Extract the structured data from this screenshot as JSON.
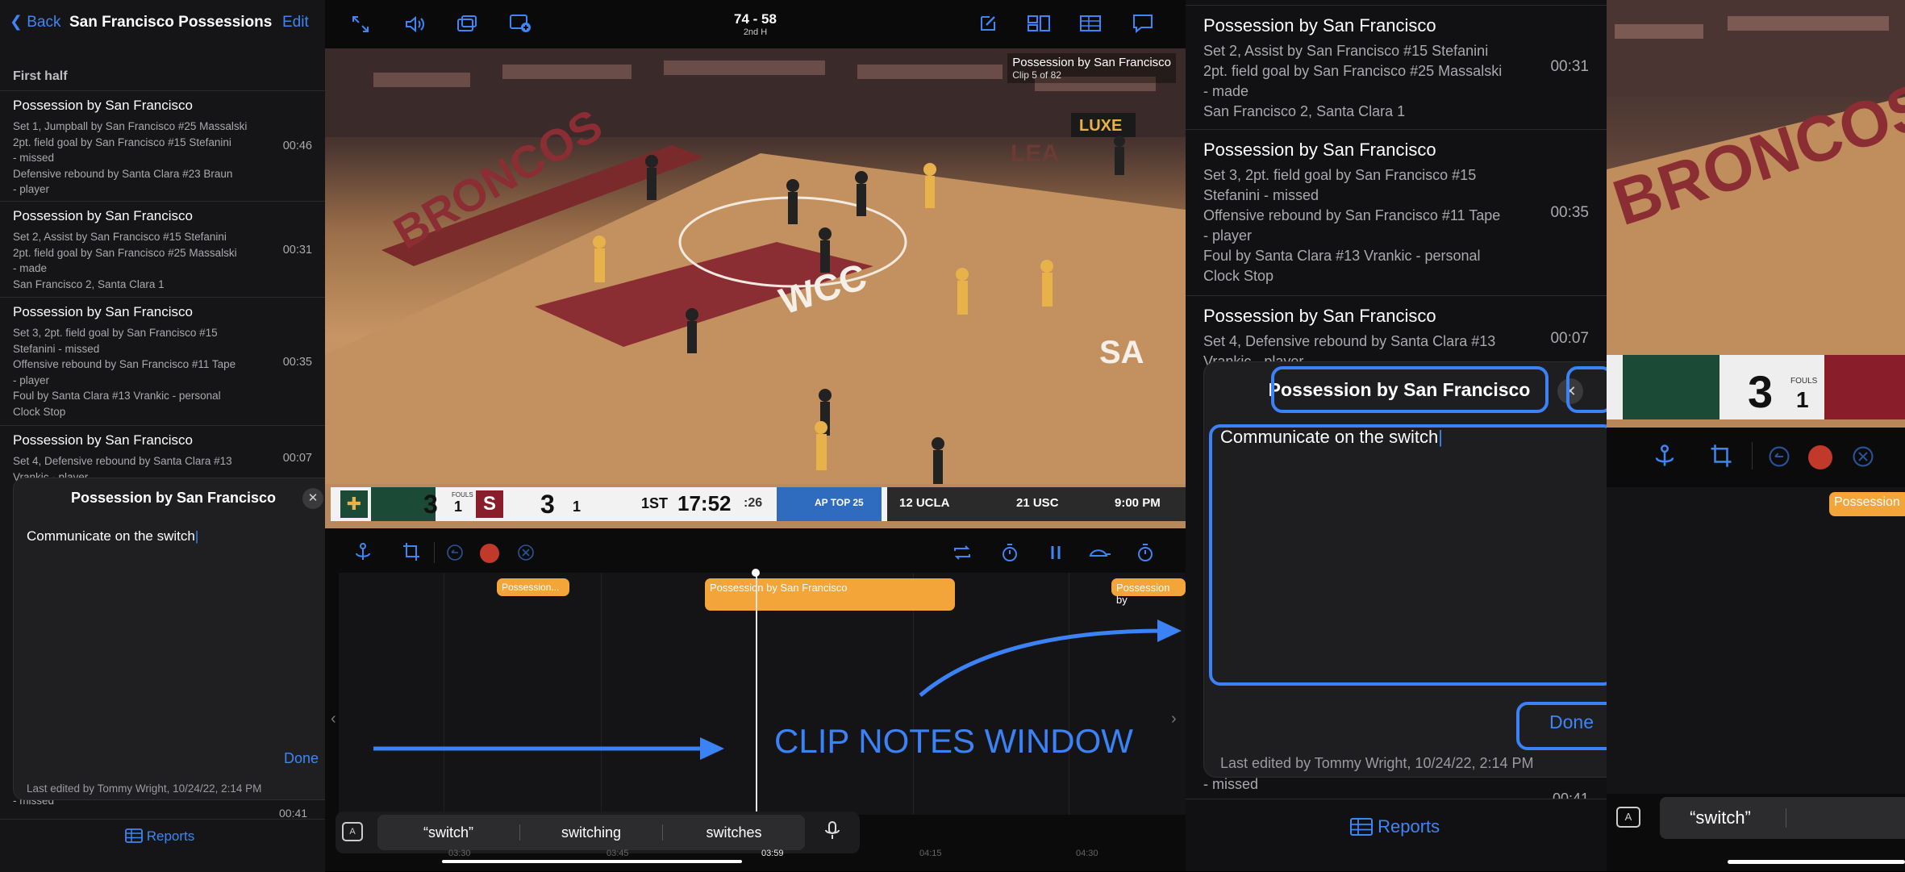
{
  "left_panel": {
    "back_label": "Back",
    "title": "San Francisco Possessions",
    "edit_label": "Edit",
    "section": "First half",
    "rows": [
      {
        "title": "Possession by San Francisco",
        "lines": [
          "Set 1, Jumpball by San Francisco #25 Massalski",
          "2pt. field goal by San Francisco #15 Stefanini",
          "- missed",
          "Defensive rebound by Santa Clara #23 Braun",
          "- player"
        ],
        "time": "00:46"
      },
      {
        "title": "Possession by San Francisco",
        "lines": [
          "Set 2, Assist by San Francisco #15 Stefanini",
          "2pt. field goal by San Francisco #25 Massalski",
          "- made",
          "San Francisco 2, Santa Clara 1"
        ],
        "time": "00:31"
      },
      {
        "title": "Possession by San Francisco",
        "lines": [
          "Set 3, 2pt. field goal by San Francisco #15",
          "Stefanini - missed",
          "Offensive rebound by San Francisco #11 Tape",
          "- player",
          "Foul by Santa Clara #13 Vrankic - personal",
          "Clock Stop"
        ],
        "time": "00:35"
      },
      {
        "title": "Possession by San Francisco",
        "lines": [
          "Set 4, Defensive rebound by Santa Clara #13",
          "Vrankic - player"
        ],
        "time": "00:07"
      }
    ],
    "below_note_lines": [
      "- missed"
    ],
    "below_note_time": "00:41",
    "reports_label": "Reports"
  },
  "note": {
    "title": "Possession by San Francisco",
    "close_symbol": "✕",
    "body": "Communicate on the switch",
    "done_label": "Done",
    "edited": "Last edited by Tommy Wright, 10/24/22, 2:14 PM"
  },
  "video": {
    "score_header": "74 - 58",
    "period": "2nd H",
    "overlay_title": "Possession by San Francisco",
    "overlay_sub": "Clip 5 of 82",
    "scorebug": {
      "home_score": "3",
      "away_score": "3",
      "half": "1ST",
      "clock": "17:52",
      "shot_clock": ":26",
      "ticker_brand": "AP TOP 25",
      "ticker_1": "12 UCLA",
      "ticker_2": "21 USC",
      "ticker_time": "9:00 PM",
      "fouls_label": "FOULS",
      "fouls_home": "1",
      "fouls_away": "1"
    },
    "court_text": [
      "BRONCOS",
      "WCC",
      "LEA",
      "SA",
      "LUXE"
    ]
  },
  "timeline": {
    "clips": [
      "Possession...",
      "Possession by San Francisco",
      "Possession by"
    ],
    "ticks": [
      "03:30",
      "03:45",
      "03:59",
      "04:15",
      "04:30"
    ],
    "chevron_left": "‹",
    "chevron_right": "›"
  },
  "keyboard": {
    "suggestions": [
      "“switch”",
      "switching",
      "switches"
    ],
    "format_key": "A"
  },
  "annotation": {
    "label": "CLIP NOTES WINDOW",
    "color": "#3b82f6"
  },
  "right_panel": {
    "rows": [
      {
        "title": "Possession by San Francisco",
        "lines": [
          "Set 2, Assist by San Francisco #15 Stefanini",
          "2pt. field goal by San Francisco #25 Massalski",
          "- made",
          "San Francisco 2, Santa Clara 1"
        ],
        "time": "00:31"
      },
      {
        "title": "Possession by San Francisco",
        "lines": [
          "Set 3, 2pt. field goal by San Francisco #15",
          "Stefanini - missed",
          "Offensive rebound by San Francisco #11 Tape",
          "- player",
          "Foul by Santa Clara #13 Vrankic - personal",
          "Clock Stop"
        ],
        "time": "00:35"
      },
      {
        "title": "Possession by San Francisco",
        "lines": [
          "Set 4, Defensive rebound by Santa Clara #13",
          "Vrankic - player"
        ],
        "time": "00:07"
      }
    ],
    "below_lines": [
      "- missed"
    ],
    "below_time": "00:41",
    "reports_label": "Reports",
    "far_clip_label": "Possession",
    "far_suggestion": "“switch”"
  },
  "colors": {
    "accent": "#3d86f5",
    "clip": "#f3a53a",
    "record": "#c0392b",
    "highlight": "#3b82f6"
  }
}
